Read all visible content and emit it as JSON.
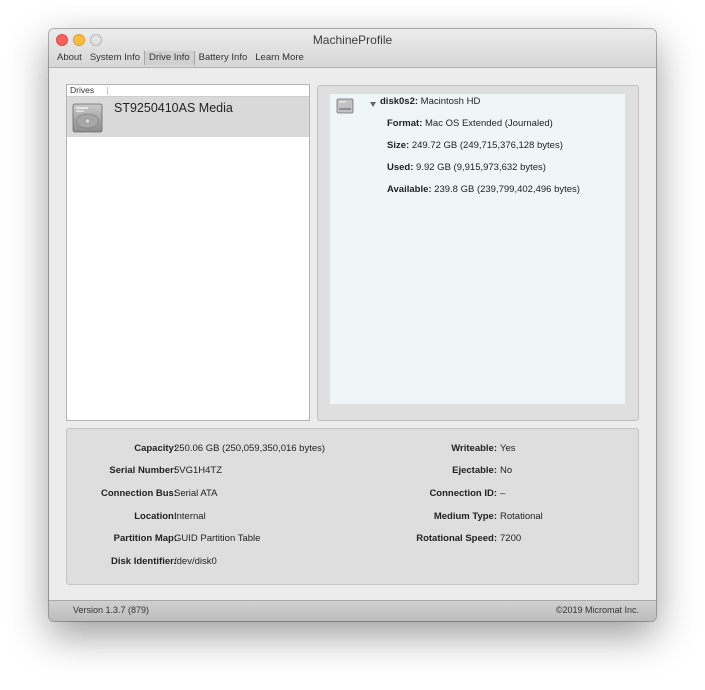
{
  "window": {
    "title": "MachineProfile"
  },
  "tabs": [
    {
      "label": "About"
    },
    {
      "label": "System Info"
    },
    {
      "label": "Drive Info",
      "active": true
    },
    {
      "label": "Battery Info"
    },
    {
      "label": "Learn More"
    }
  ],
  "drives": {
    "header": "Drives",
    "items": [
      {
        "name": "ST9250410AS Media",
        "icon": "hard-drive-icon"
      }
    ]
  },
  "volume": {
    "icon": "volume-icon",
    "id_label": "disk0s2:",
    "id_value": "Macintosh HD",
    "properties": [
      {
        "label": "Format:",
        "value": "Mac OS Extended (Journaled)"
      },
      {
        "label": "Size:",
        "value": "249.72 GB (249,715,376,128 bytes)"
      },
      {
        "label": "Used:",
        "value": "9.92 GB (9,915,973,632 bytes)"
      },
      {
        "label": "Available:",
        "value": "239.8 GB (239,799,402,496 bytes)"
      }
    ]
  },
  "drive_info": {
    "left": [
      {
        "label": "Capacity:",
        "value": "250.06 GB (250,059,350,016 bytes)"
      },
      {
        "label": "Serial Number:",
        "value": "5VG1H4TZ"
      },
      {
        "label": "Connection Bus:",
        "value": "Serial ATA"
      },
      {
        "label": "Location:",
        "value": "Internal"
      },
      {
        "label": "Partition Map:",
        "value": "GUID Partition Table"
      },
      {
        "label": "Disk Identifier:",
        "value": "/dev/disk0"
      }
    ],
    "right": [
      {
        "label": "Writeable:",
        "value": "Yes"
      },
      {
        "label": "Ejectable:",
        "value": "No"
      },
      {
        "label": "Connection ID:",
        "value": "–"
      },
      {
        "label": "Medium Type:",
        "value": "Rotational"
      },
      {
        "label": "Rotational Speed:",
        "value": "7200"
      }
    ]
  },
  "status": {
    "version": "Version 1.3.7 (879)",
    "copyright": "©2019 Micromat Inc."
  },
  "colors": {
    "close": "#fc605c",
    "minimize": "#fdbc40",
    "zoom": "#e2e2e2",
    "selected_row": "#d9d9d9",
    "detail_background": "#f0f6f8"
  }
}
